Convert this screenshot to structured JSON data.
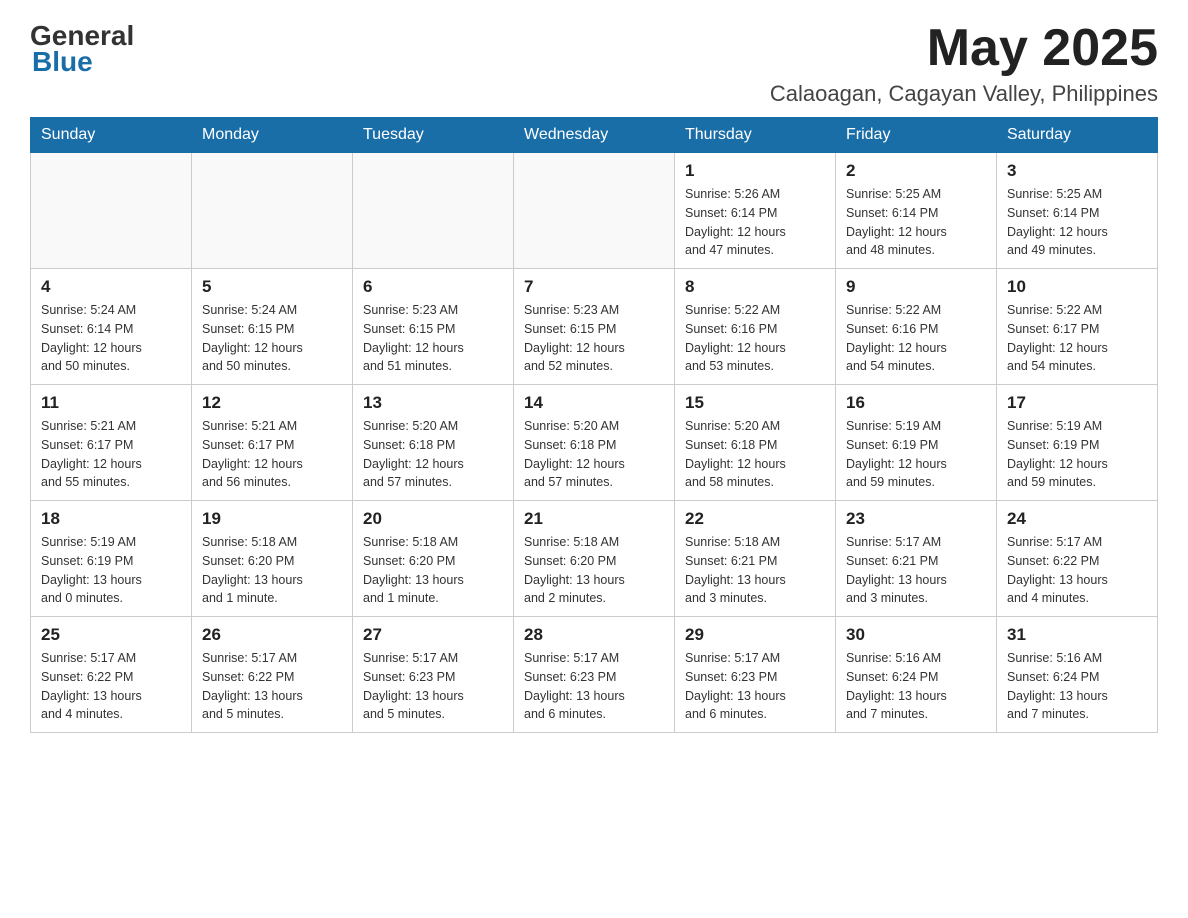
{
  "header": {
    "logo_general": "General",
    "logo_blue": "Blue",
    "month_year": "May 2025",
    "location": "Calaoagan, Cagayan Valley, Philippines"
  },
  "weekdays": [
    "Sunday",
    "Monday",
    "Tuesday",
    "Wednesday",
    "Thursday",
    "Friday",
    "Saturday"
  ],
  "weeks": [
    [
      {
        "day": "",
        "info": ""
      },
      {
        "day": "",
        "info": ""
      },
      {
        "day": "",
        "info": ""
      },
      {
        "day": "",
        "info": ""
      },
      {
        "day": "1",
        "info": "Sunrise: 5:26 AM\nSunset: 6:14 PM\nDaylight: 12 hours\nand 47 minutes."
      },
      {
        "day": "2",
        "info": "Sunrise: 5:25 AM\nSunset: 6:14 PM\nDaylight: 12 hours\nand 48 minutes."
      },
      {
        "day": "3",
        "info": "Sunrise: 5:25 AM\nSunset: 6:14 PM\nDaylight: 12 hours\nand 49 minutes."
      }
    ],
    [
      {
        "day": "4",
        "info": "Sunrise: 5:24 AM\nSunset: 6:14 PM\nDaylight: 12 hours\nand 50 minutes."
      },
      {
        "day": "5",
        "info": "Sunrise: 5:24 AM\nSunset: 6:15 PM\nDaylight: 12 hours\nand 50 minutes."
      },
      {
        "day": "6",
        "info": "Sunrise: 5:23 AM\nSunset: 6:15 PM\nDaylight: 12 hours\nand 51 minutes."
      },
      {
        "day": "7",
        "info": "Sunrise: 5:23 AM\nSunset: 6:15 PM\nDaylight: 12 hours\nand 52 minutes."
      },
      {
        "day": "8",
        "info": "Sunrise: 5:22 AM\nSunset: 6:16 PM\nDaylight: 12 hours\nand 53 minutes."
      },
      {
        "day": "9",
        "info": "Sunrise: 5:22 AM\nSunset: 6:16 PM\nDaylight: 12 hours\nand 54 minutes."
      },
      {
        "day": "10",
        "info": "Sunrise: 5:22 AM\nSunset: 6:17 PM\nDaylight: 12 hours\nand 54 minutes."
      }
    ],
    [
      {
        "day": "11",
        "info": "Sunrise: 5:21 AM\nSunset: 6:17 PM\nDaylight: 12 hours\nand 55 minutes."
      },
      {
        "day": "12",
        "info": "Sunrise: 5:21 AM\nSunset: 6:17 PM\nDaylight: 12 hours\nand 56 minutes."
      },
      {
        "day": "13",
        "info": "Sunrise: 5:20 AM\nSunset: 6:18 PM\nDaylight: 12 hours\nand 57 minutes."
      },
      {
        "day": "14",
        "info": "Sunrise: 5:20 AM\nSunset: 6:18 PM\nDaylight: 12 hours\nand 57 minutes."
      },
      {
        "day": "15",
        "info": "Sunrise: 5:20 AM\nSunset: 6:18 PM\nDaylight: 12 hours\nand 58 minutes."
      },
      {
        "day": "16",
        "info": "Sunrise: 5:19 AM\nSunset: 6:19 PM\nDaylight: 12 hours\nand 59 minutes."
      },
      {
        "day": "17",
        "info": "Sunrise: 5:19 AM\nSunset: 6:19 PM\nDaylight: 12 hours\nand 59 minutes."
      }
    ],
    [
      {
        "day": "18",
        "info": "Sunrise: 5:19 AM\nSunset: 6:19 PM\nDaylight: 13 hours\nand 0 minutes."
      },
      {
        "day": "19",
        "info": "Sunrise: 5:18 AM\nSunset: 6:20 PM\nDaylight: 13 hours\nand 1 minute."
      },
      {
        "day": "20",
        "info": "Sunrise: 5:18 AM\nSunset: 6:20 PM\nDaylight: 13 hours\nand 1 minute."
      },
      {
        "day": "21",
        "info": "Sunrise: 5:18 AM\nSunset: 6:20 PM\nDaylight: 13 hours\nand 2 minutes."
      },
      {
        "day": "22",
        "info": "Sunrise: 5:18 AM\nSunset: 6:21 PM\nDaylight: 13 hours\nand 3 minutes."
      },
      {
        "day": "23",
        "info": "Sunrise: 5:17 AM\nSunset: 6:21 PM\nDaylight: 13 hours\nand 3 minutes."
      },
      {
        "day": "24",
        "info": "Sunrise: 5:17 AM\nSunset: 6:22 PM\nDaylight: 13 hours\nand 4 minutes."
      }
    ],
    [
      {
        "day": "25",
        "info": "Sunrise: 5:17 AM\nSunset: 6:22 PM\nDaylight: 13 hours\nand 4 minutes."
      },
      {
        "day": "26",
        "info": "Sunrise: 5:17 AM\nSunset: 6:22 PM\nDaylight: 13 hours\nand 5 minutes."
      },
      {
        "day": "27",
        "info": "Sunrise: 5:17 AM\nSunset: 6:23 PM\nDaylight: 13 hours\nand 5 minutes."
      },
      {
        "day": "28",
        "info": "Sunrise: 5:17 AM\nSunset: 6:23 PM\nDaylight: 13 hours\nand 6 minutes."
      },
      {
        "day": "29",
        "info": "Sunrise: 5:17 AM\nSunset: 6:23 PM\nDaylight: 13 hours\nand 6 minutes."
      },
      {
        "day": "30",
        "info": "Sunrise: 5:16 AM\nSunset: 6:24 PM\nDaylight: 13 hours\nand 7 minutes."
      },
      {
        "day": "31",
        "info": "Sunrise: 5:16 AM\nSunset: 6:24 PM\nDaylight: 13 hours\nand 7 minutes."
      }
    ]
  ]
}
